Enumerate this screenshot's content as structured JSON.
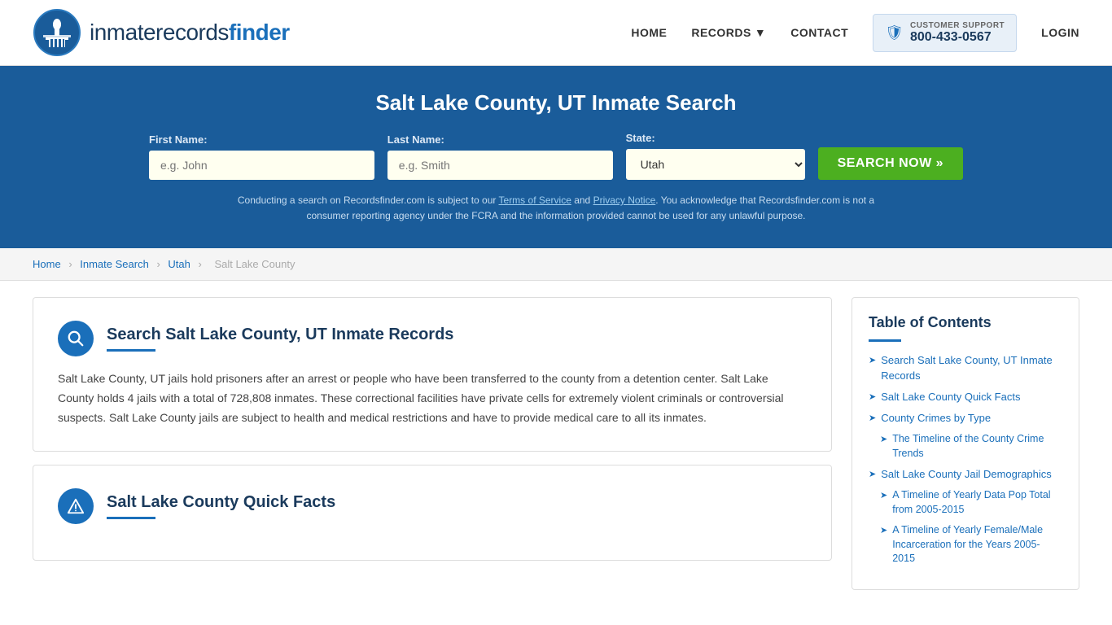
{
  "header": {
    "logo_text_light": "inmaterecords",
    "logo_text_bold": "finder",
    "nav": {
      "home": "HOME",
      "records": "RECORDS",
      "contact": "CONTACT",
      "login": "LOGIN"
    },
    "customer_support": {
      "label": "CUSTOMER SUPPORT",
      "phone": "800-433-0567"
    }
  },
  "hero": {
    "title": "Salt Lake County, UT Inmate Search",
    "first_name_label": "First Name:",
    "first_name_placeholder": "e.g. John",
    "last_name_label": "Last Name:",
    "last_name_placeholder": "e.g. Smith",
    "state_label": "State:",
    "state_value": "Utah",
    "search_button": "SEARCH NOW »",
    "disclaimer": "Conducting a search on Recordsfinder.com is subject to our Terms of Service and Privacy Notice. You acknowledge that Recordsfinder.com is not a consumer reporting agency under the FCRA and the information provided cannot be used for any unlawful purpose.",
    "terms_link": "Terms of Service",
    "privacy_link": "Privacy Notice"
  },
  "breadcrumb": {
    "items": [
      "Home",
      "Inmate Search",
      "Utah",
      "Salt Lake County"
    ]
  },
  "main_section": {
    "card1": {
      "title": "Search Salt Lake County, UT Inmate Records",
      "body": "Salt Lake County, UT jails hold prisoners after an arrest or people who have been transferred to the county from a detention center. Salt Lake County holds 4 jails with a total of 728,808 inmates. These correctional facilities have private cells for extremely violent criminals or controversial suspects. Salt Lake County jails are subject to health and medical restrictions and have to provide medical care to all its inmates."
    },
    "card2": {
      "title": "Salt Lake County Quick Facts"
    }
  },
  "toc": {
    "title": "Table of Contents",
    "items": [
      {
        "label": "Search Salt Lake County, UT Inmate Records",
        "sub": false
      },
      {
        "label": "Salt Lake County Quick Facts",
        "sub": false
      },
      {
        "label": "County Crimes by Type",
        "sub": false
      },
      {
        "label": "The Timeline of the County Crime Trends",
        "sub": true
      },
      {
        "label": "Salt Lake County Jail Demographics",
        "sub": false
      },
      {
        "label": "A Timeline of Yearly Data Pop Total from 2005-2015",
        "sub": true
      },
      {
        "label": "A Timeline of Yearly Female/Male Incarceration for the Years 2005-2015",
        "sub": true
      }
    ]
  }
}
